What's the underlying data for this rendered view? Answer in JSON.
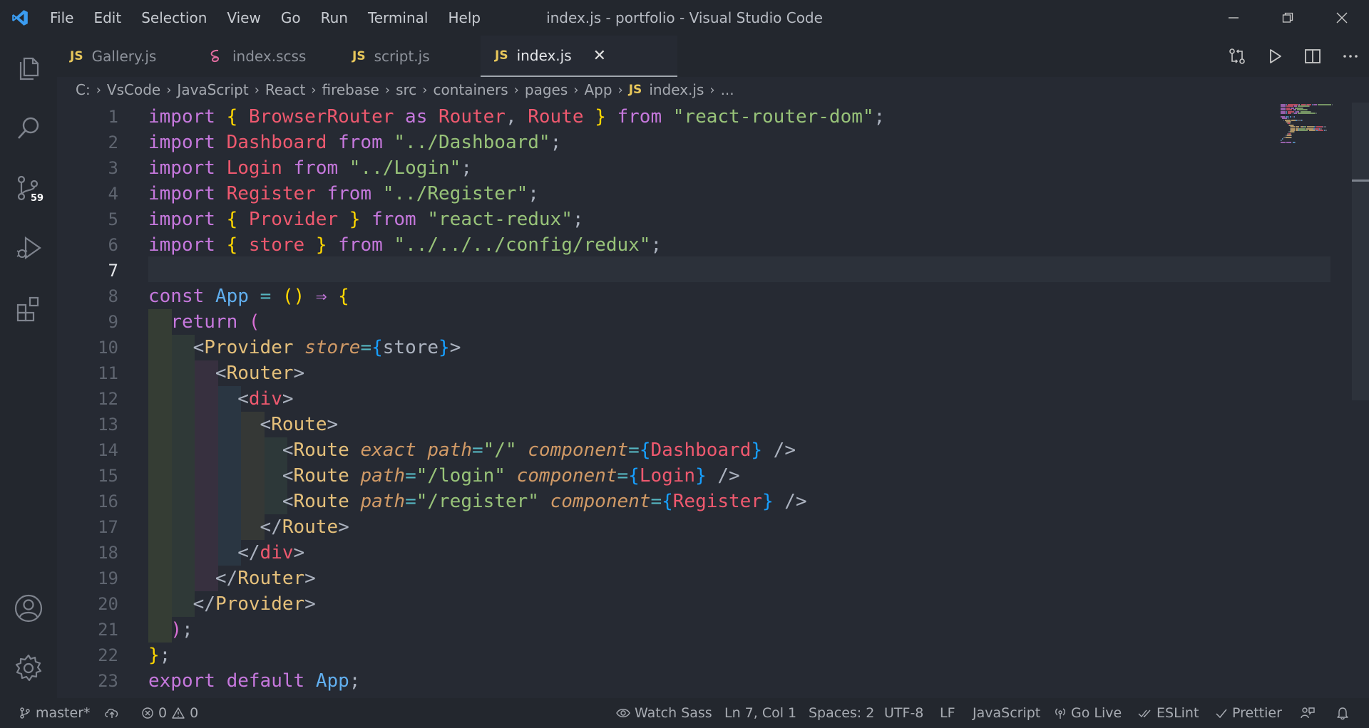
{
  "window": {
    "title": "index.js - portfolio - Visual Studio Code"
  },
  "menu": [
    "File",
    "Edit",
    "Selection",
    "View",
    "Go",
    "Run",
    "Terminal",
    "Help"
  ],
  "activity_bar": {
    "source_control_badge": "59"
  },
  "tabs": [
    {
      "icon": "JS",
      "label": "Gallery.js",
      "active": false
    },
    {
      "icon": "sass",
      "label": "index.scss",
      "active": false
    },
    {
      "icon": "JS",
      "label": "script.js",
      "active": false
    },
    {
      "icon": "JS",
      "label": "index.js",
      "active": true
    }
  ],
  "tab_close_glyph": "✕",
  "breadcrumb": {
    "parts": [
      "C:",
      "VsCode",
      "JavaScript",
      "React",
      "firebase",
      "src",
      "containers",
      "pages",
      "App"
    ],
    "file_icon": "JS",
    "file": "index.js",
    "ellipsis": "..."
  },
  "editor": {
    "active_line": 7,
    "line_numbers": [
      "1",
      "2",
      "3",
      "4",
      "5",
      "6",
      "7",
      "8",
      "9",
      "10",
      "11",
      "12",
      "13",
      "14",
      "15",
      "16",
      "17",
      "18",
      "19",
      "20",
      "21",
      "22",
      "23"
    ],
    "lines": [
      [
        [
          "kw",
          "import"
        ],
        [
          "pn",
          " "
        ],
        [
          "br1",
          "{"
        ],
        [
          "pn",
          " "
        ],
        [
          "var",
          "BrowserRouter"
        ],
        [
          "pn",
          " "
        ],
        [
          "kw",
          "as"
        ],
        [
          "pn",
          " "
        ],
        [
          "var",
          "Router"
        ],
        [
          "pn",
          ", "
        ],
        [
          "var",
          "Route"
        ],
        [
          "pn",
          " "
        ],
        [
          "br1",
          "}"
        ],
        [
          "pn",
          " "
        ],
        [
          "kw",
          "from"
        ],
        [
          "pn",
          " "
        ],
        [
          "str",
          "\"react-router-dom\""
        ],
        [
          "pn",
          ";"
        ]
      ],
      [
        [
          "kw",
          "import"
        ],
        [
          "pn",
          " "
        ],
        [
          "var",
          "Dashboard"
        ],
        [
          "pn",
          " "
        ],
        [
          "kw",
          "from"
        ],
        [
          "pn",
          " "
        ],
        [
          "str",
          "\"../Dashboard\""
        ],
        [
          "pn",
          ";"
        ]
      ],
      [
        [
          "kw",
          "import"
        ],
        [
          "pn",
          " "
        ],
        [
          "var",
          "Login"
        ],
        [
          "pn",
          " "
        ],
        [
          "kw",
          "from"
        ],
        [
          "pn",
          " "
        ],
        [
          "str",
          "\"../Login\""
        ],
        [
          "pn",
          ";"
        ]
      ],
      [
        [
          "kw",
          "import"
        ],
        [
          "pn",
          " "
        ],
        [
          "var",
          "Register"
        ],
        [
          "pn",
          " "
        ],
        [
          "kw",
          "from"
        ],
        [
          "pn",
          " "
        ],
        [
          "str",
          "\"../Register\""
        ],
        [
          "pn",
          ";"
        ]
      ],
      [
        [
          "kw",
          "import"
        ],
        [
          "pn",
          " "
        ],
        [
          "br1",
          "{"
        ],
        [
          "pn",
          " "
        ],
        [
          "var",
          "Provider"
        ],
        [
          "pn",
          " "
        ],
        [
          "br1",
          "}"
        ],
        [
          "pn",
          " "
        ],
        [
          "kw",
          "from"
        ],
        [
          "pn",
          " "
        ],
        [
          "str",
          "\"react-redux\""
        ],
        [
          "pn",
          ";"
        ]
      ],
      [
        [
          "kw",
          "import"
        ],
        [
          "pn",
          " "
        ],
        [
          "br1",
          "{"
        ],
        [
          "pn",
          " "
        ],
        [
          "var",
          "store"
        ],
        [
          "pn",
          " "
        ],
        [
          "br1",
          "}"
        ],
        [
          "pn",
          " "
        ],
        [
          "kw",
          "from"
        ],
        [
          "pn",
          " "
        ],
        [
          "str",
          "\"../../../config/redux\""
        ],
        [
          "pn",
          ";"
        ]
      ],
      [],
      [
        [
          "kw",
          "const"
        ],
        [
          "pn",
          " "
        ],
        [
          "fn",
          "App"
        ],
        [
          "pn",
          " "
        ],
        [
          "op",
          "="
        ],
        [
          "pn",
          " "
        ],
        [
          "br1",
          "()"
        ],
        [
          "pn",
          " "
        ],
        [
          "kw",
          "⇒"
        ],
        [
          "pn",
          " "
        ],
        [
          "br1",
          "{"
        ]
      ],
      [
        [
          "pn",
          "  "
        ],
        [
          "kw",
          "return"
        ],
        [
          "pn",
          " "
        ],
        [
          "br2",
          "("
        ]
      ],
      [
        [
          "pn",
          "    "
        ],
        [
          "pn",
          "<"
        ],
        [
          "tag",
          "Provider"
        ],
        [
          "pn",
          " "
        ],
        [
          "attr",
          "store"
        ],
        [
          "op",
          "="
        ],
        [
          "br3",
          "{"
        ],
        [
          "pn",
          "store"
        ],
        [
          "br3",
          "}"
        ],
        [
          "pn",
          ">"
        ]
      ],
      [
        [
          "pn",
          "      "
        ],
        [
          "pn",
          "<"
        ],
        [
          "tag",
          "Router"
        ],
        [
          "pn",
          ">"
        ]
      ],
      [
        [
          "pn",
          "        "
        ],
        [
          "pn",
          "<"
        ],
        [
          "tagn",
          "div"
        ],
        [
          "pn",
          ">"
        ]
      ],
      [
        [
          "pn",
          "          "
        ],
        [
          "pn",
          "<"
        ],
        [
          "tag",
          "Route"
        ],
        [
          "pn",
          ">"
        ]
      ],
      [
        [
          "pn",
          "            "
        ],
        [
          "pn",
          "<"
        ],
        [
          "tag",
          "Route"
        ],
        [
          "pn",
          " "
        ],
        [
          "attr",
          "exact"
        ],
        [
          "pn",
          " "
        ],
        [
          "attr",
          "path"
        ],
        [
          "op",
          "="
        ],
        [
          "str",
          "\"/\""
        ],
        [
          "pn",
          " "
        ],
        [
          "attr",
          "component"
        ],
        [
          "op",
          "="
        ],
        [
          "br3",
          "{"
        ],
        [
          "var",
          "Dashboard"
        ],
        [
          "br3",
          "}"
        ],
        [
          "pn",
          " />"
        ]
      ],
      [
        [
          "pn",
          "            "
        ],
        [
          "pn",
          "<"
        ],
        [
          "tag",
          "Route"
        ],
        [
          "pn",
          " "
        ],
        [
          "attr",
          "path"
        ],
        [
          "op",
          "="
        ],
        [
          "str",
          "\"/login\""
        ],
        [
          "pn",
          " "
        ],
        [
          "attr",
          "component"
        ],
        [
          "op",
          "="
        ],
        [
          "br3",
          "{"
        ],
        [
          "var",
          "Login"
        ],
        [
          "br3",
          "}"
        ],
        [
          "pn",
          " />"
        ]
      ],
      [
        [
          "pn",
          "            "
        ],
        [
          "pn",
          "<"
        ],
        [
          "tag",
          "Route"
        ],
        [
          "pn",
          " "
        ],
        [
          "attr",
          "path"
        ],
        [
          "op",
          "="
        ],
        [
          "str",
          "\"/register\""
        ],
        [
          "pn",
          " "
        ],
        [
          "attr",
          "component"
        ],
        [
          "op",
          "="
        ],
        [
          "br3",
          "{"
        ],
        [
          "var",
          "Register"
        ],
        [
          "br3",
          "}"
        ],
        [
          "pn",
          " />"
        ]
      ],
      [
        [
          "pn",
          "          "
        ],
        [
          "pn",
          "</"
        ],
        [
          "tag",
          "Route"
        ],
        [
          "pn",
          ">"
        ]
      ],
      [
        [
          "pn",
          "        "
        ],
        [
          "pn",
          "</"
        ],
        [
          "tagn",
          "div"
        ],
        [
          "pn",
          ">"
        ]
      ],
      [
        [
          "pn",
          "      "
        ],
        [
          "pn",
          "</"
        ],
        [
          "tag",
          "Router"
        ],
        [
          "pn",
          ">"
        ]
      ],
      [
        [
          "pn",
          "    "
        ],
        [
          "pn",
          "</"
        ],
        [
          "tag",
          "Provider"
        ],
        [
          "pn",
          ">"
        ]
      ],
      [
        [
          "pn",
          "  "
        ],
        [
          "br2",
          ")"
        ],
        [
          "pn",
          ";"
        ]
      ],
      [
        [
          "br1",
          "}"
        ],
        [
          "pn",
          ";"
        ]
      ],
      [
        [
          "kw",
          "export"
        ],
        [
          "pn",
          " "
        ],
        [
          "kw",
          "default"
        ],
        [
          "pn",
          " "
        ],
        [
          "fn",
          "App"
        ],
        [
          "pn",
          ";"
        ]
      ]
    ]
  },
  "status": {
    "branch": "master*",
    "errors": "0",
    "warnings": "0",
    "watch_sass": "Watch Sass",
    "cursor": "Ln 7, Col 1",
    "spaces": "Spaces: 2",
    "encoding": "UTF-8",
    "eol": "LF",
    "language": "JavaScript",
    "go_live": "Go Live",
    "eslint": "ESLint",
    "prettier": "Prettier"
  },
  "colors": {
    "background": "#262a33",
    "chrome": "#23272e",
    "accent": "#3b9cf0",
    "keyword": "#c678dd",
    "string": "#98c379",
    "variable": "#ef596f",
    "tag": "#e5c07b"
  }
}
